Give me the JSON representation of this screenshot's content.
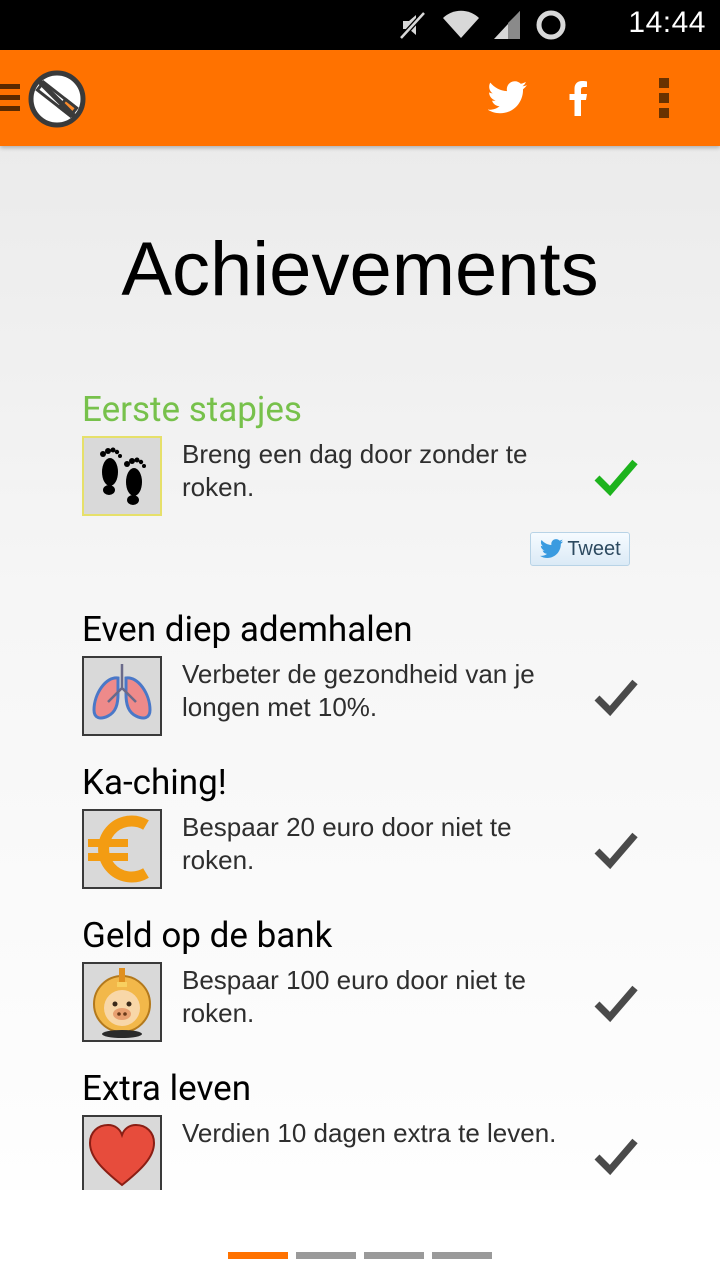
{
  "status_bar": {
    "time": "14:44",
    "icons": [
      "mute-icon",
      "wifi-icon",
      "signal-icon",
      "sync-icon"
    ]
  },
  "action_bar": {
    "app_icon": "no-smoking-logo",
    "actions": [
      "twitter-icon",
      "facebook-icon",
      "overflow-menu-icon"
    ],
    "color": "#ff7200"
  },
  "page": {
    "title": "Achievements"
  },
  "achievements": [
    {
      "title": "Eerste stapjes",
      "description": "Breng een dag door zonder te roken.",
      "icon": "footprints-icon",
      "status": "unlocked",
      "share_label": "Tweet"
    },
    {
      "title": "Even diep ademhalen",
      "description": "Verbeter de gezondheid van je longen met 10%.",
      "icon": "lungs-icon",
      "status": "locked"
    },
    {
      "title": "Ka-ching!",
      "description": "Bespaar 20 euro door niet te roken.",
      "icon": "euro-icon",
      "status": "locked"
    },
    {
      "title": "Geld op de bank",
      "description": "Bespaar 100 euro door niet te roken.",
      "icon": "piggy-bank-icon",
      "status": "locked"
    },
    {
      "title": "Extra leven",
      "description": "Verdien 10 dagen extra te leven.",
      "icon": "heart-icon",
      "status": "locked"
    }
  ],
  "pager": {
    "pages": 4,
    "active": 1
  },
  "colors": {
    "accent": "#ff7200",
    "unlocked_title": "#77c14b",
    "unlocked_check": "#1db31d",
    "locked_check": "#4a4a4a"
  }
}
